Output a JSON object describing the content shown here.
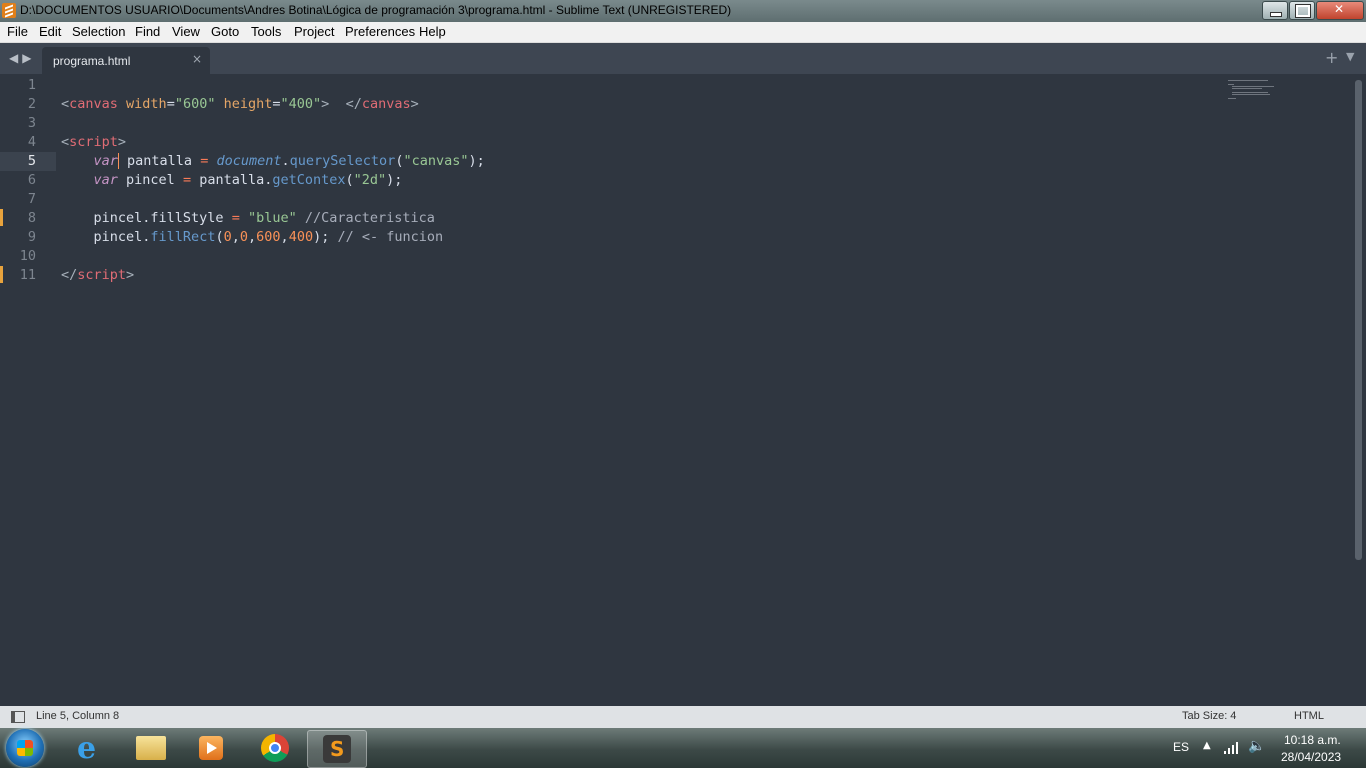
{
  "window": {
    "title": "D:\\DOCUMENTOS USUARIO\\Documents\\Andres Botina\\Lógica de programación 3\\programa.html - Sublime Text (UNREGISTERED)",
    "icons": {
      "app": "sublime-text-icon",
      "minimize": "minimize-icon",
      "maximize": "maximize-icon",
      "close": "close-icon"
    }
  },
  "menu": {
    "items": [
      "File",
      "Edit",
      "Selection",
      "Find",
      "View",
      "Goto",
      "Tools",
      "Project",
      "Preferences",
      "Help"
    ]
  },
  "tabs": {
    "active": {
      "label": "programa.html",
      "close": "×"
    },
    "plus": "+",
    "dropdown": "▼"
  },
  "editor": {
    "line_numbers": [
      "1",
      "2",
      "3",
      "4",
      "5",
      "6",
      "7",
      "8",
      "9",
      "10",
      "11"
    ],
    "current_line": 5,
    "modified_lines": [
      8,
      11
    ],
    "code": {
      "l2": {
        "t1": "<",
        "t2": "canvas",
        "t3": " width",
        "t4": "=",
        "t5": "\"600\"",
        "t6": " height",
        "t7": "=",
        "t8": "\"400\"",
        "t9": ">",
        "t10": "  </",
        "t11": "canvas",
        "t12": ">"
      },
      "l4": {
        "t1": "<",
        "t2": "script",
        "t3": ">"
      },
      "l5": {
        "indent": "    ",
        "t1": "var",
        "t2": " pantalla ",
        "t3": "=",
        "t4": " ",
        "t5": "document",
        "t6": ".",
        "t7": "querySelector",
        "t8": "(",
        "t9": "\"canvas\"",
        "t10": ");"
      },
      "l6": {
        "indent": "    ",
        "t1": "var",
        "t2": " pincel ",
        "t3": "=",
        "t4": " pantalla.",
        "t5": "getContex",
        "t6": "(",
        "t7": "\"2d\"",
        "t8": ");"
      },
      "l8": {
        "indent": "    ",
        "t1": "pincel.fillStyle ",
        "t2": "=",
        "t3": " ",
        "t4": "\"blue\"",
        "t5": " ",
        "t6": "//Caracteristica"
      },
      "l9": {
        "indent": "    ",
        "t1": "pincel.",
        "t2": "fillRect",
        "t3": "(",
        "t4": "0",
        "t5": ",",
        "t6": "0",
        "t7": ",",
        "t8": "600",
        "t9": ",",
        "t10": "400",
        "t11": "); ",
        "t12": "// <- funcion"
      },
      "l11": {
        "t1": "</",
        "t2": "script",
        "t3": ">"
      }
    }
  },
  "status": {
    "position": "Line 5, Column 8",
    "tab_size": "Tab Size: 4",
    "syntax": "HTML"
  },
  "taskbar": {
    "apps": [
      "start-button",
      "internet-explorer-icon",
      "file-explorer-icon",
      "media-player-icon",
      "chrome-icon",
      "sublime-text-icon"
    ],
    "language": "ES",
    "time": "10:18 a.m.",
    "date": "28/04/2023"
  },
  "colors": {
    "editor_bg": "#2f3640",
    "tag": "#e06c75",
    "string": "#99c794",
    "number": "#f99157",
    "keyword": "#c594c5",
    "function": "#6699cc",
    "modified_marker": "#e8a33d"
  }
}
